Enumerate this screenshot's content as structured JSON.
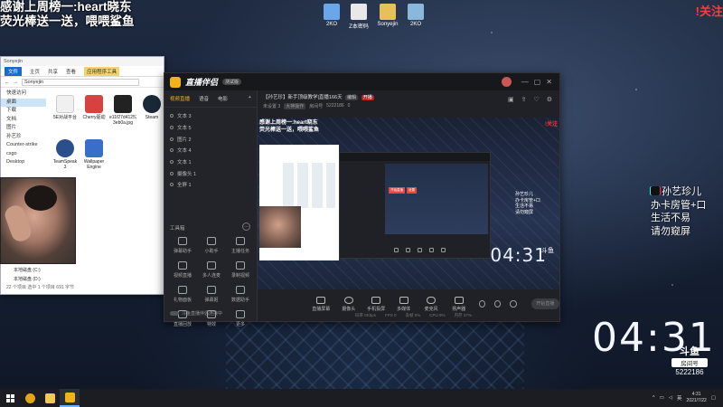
{
  "overlay": {
    "line1": "感谢上周榜一:heart晓东",
    "line2": "荧光棒送一送，喂喂鲨鱼",
    "follow": "!关注"
  },
  "desktop_icons": [
    {
      "label": "2KO",
      "color": "#6aa6e8"
    },
    {
      "label": "Z本密码",
      "color": "#e8e8e8"
    },
    {
      "label": "Sonyejin",
      "color": "#e5c15a"
    },
    {
      "label": "2KO",
      "color": "#8ab8d8"
    }
  ],
  "explorer": {
    "title": "Sonyejin",
    "tabs": [
      "文件",
      "主页",
      "共享",
      "查看"
    ],
    "manage_tab": "应用程序工具",
    "address": "Sonyejin",
    "nav": [
      "快速访问",
      "桌面",
      "下载",
      "文档",
      "图片",
      "孙艺珍",
      "Counter-strike",
      "csgo",
      "Desktop",
      "",
      "",
      "",
      "",
      "",
      "",
      "",
      "",
      "",
      "本地磁盘 (C:)",
      "本地磁盘 (D:)"
    ],
    "files": [
      {
        "name": "5E对战平台",
        "color": "#f0f0f0"
      },
      {
        "name": "Cherry驱动",
        "color": "#d94040"
      },
      {
        "name": "e11f27d4125308877790520727 3eb0a.jpg",
        "color": "#222"
      },
      {
        "name": "Steam",
        "color": "#1b2838"
      },
      {
        "name": "TeamSpeak 3",
        "color": "#2a4f8a"
      },
      {
        "name": "Wallpaper Engine",
        "color": "#3a6fc9"
      }
    ],
    "status": "22 个项目   选中 1 个项目  691 字节"
  },
  "app": {
    "brand": "直播伴侣",
    "version": "测试版",
    "window_controls": [
      "—",
      "▢",
      "✕"
    ],
    "left_tabs": [
      "视频直播",
      "语音",
      "电影"
    ],
    "sources": [
      "文本 3",
      "文本 5",
      "图片 2",
      "文本 4",
      "文本 1",
      "摄像头 1",
      "全屏 1"
    ],
    "tools_label": "工具箱",
    "tools_more": "…",
    "tools": [
      "弹幕助手",
      "小助手",
      "主播任务",
      "视频直播",
      "多人连麦",
      "录制视频",
      "礼物面板",
      "弹幕姬",
      "数据助手",
      "直播回放",
      "特效",
      "更多"
    ],
    "foot_note": "斗鱼直播伴侣连接中",
    "live": {
      "title": "【孙艺珍】新手顶级教学|直播166天",
      "tag1": "编辑",
      "tag2": "开播",
      "category": "大神操作",
      "sub_prefix": "未设置 3",
      "room_label": "房间号",
      "room_id": "5222186",
      "views": "0"
    },
    "preview": {
      "line1": "感谢上周榜一:heart晓东",
      "line2": "荧光棒送一送，喂喂鲨鱼",
      "follow": "!关注",
      "btn1": "开始直播",
      "btn2": "设置",
      "right_lines": [
        "孙艺珍儿",
        "办卡房管+口",
        "生活不易",
        "请勿窥屏"
      ],
      "clock": "04:31",
      "logo": "斗鱼"
    },
    "controls": [
      "直播屏幕",
      "摄像头",
      "手机投屏",
      "多媒体",
      "麦克风",
      "扬声器"
    ],
    "start_button": "开始直播",
    "stats": [
      "码率 0Kbps",
      "FPS 0",
      "丢帧 0%",
      "CPU 9%",
      "内存 37%"
    ]
  },
  "right_overlay": {
    "lines": [
      "孙艺珍儿",
      "办卡房管+口",
      "生活不易",
      "请勿窥屏"
    ],
    "clock": "04:31",
    "douyu_logo": "斗鱼",
    "room_label": "房间号",
    "room_id": "5222186"
  },
  "taskbar": {
    "apps": [
      {
        "name": "chrome",
        "color": "#e4a41c"
      },
      {
        "name": "explorer",
        "color": "#f2c94c"
      },
      {
        "name": "live-assistant",
        "color": "#f2b21b"
      }
    ],
    "tray_lang": "英",
    "time": "4:31",
    "date": "2021/7/22"
  }
}
